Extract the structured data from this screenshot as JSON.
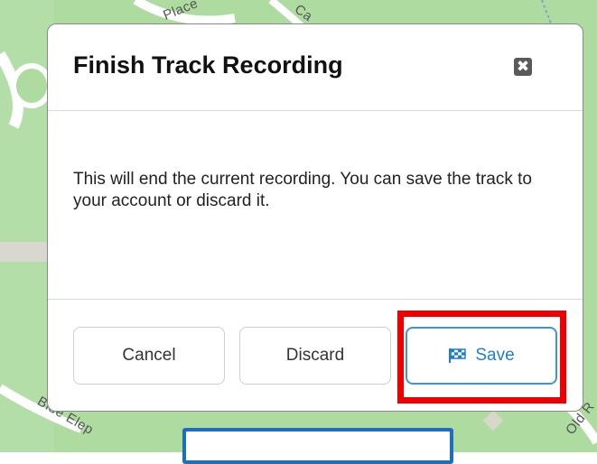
{
  "map": {
    "street_labels": [
      "Place",
      "Ca",
      "Blue Elep",
      "Old R"
    ]
  },
  "dialog": {
    "title": "Finish Track Recording",
    "close_symbol": "✖",
    "message": "This will end the current recording. You can save the track to your account or discard it.",
    "buttons": {
      "cancel_label": "Cancel",
      "discard_label": "Discard",
      "save_label": "Save"
    },
    "save_icon": "checkered-flag-icon"
  },
  "colors": {
    "map_green": "#aedba0",
    "save_accent": "#1f7fc9",
    "highlight_red": "#ee0000",
    "bottom_border_blue": "#1b6fbb"
  }
}
